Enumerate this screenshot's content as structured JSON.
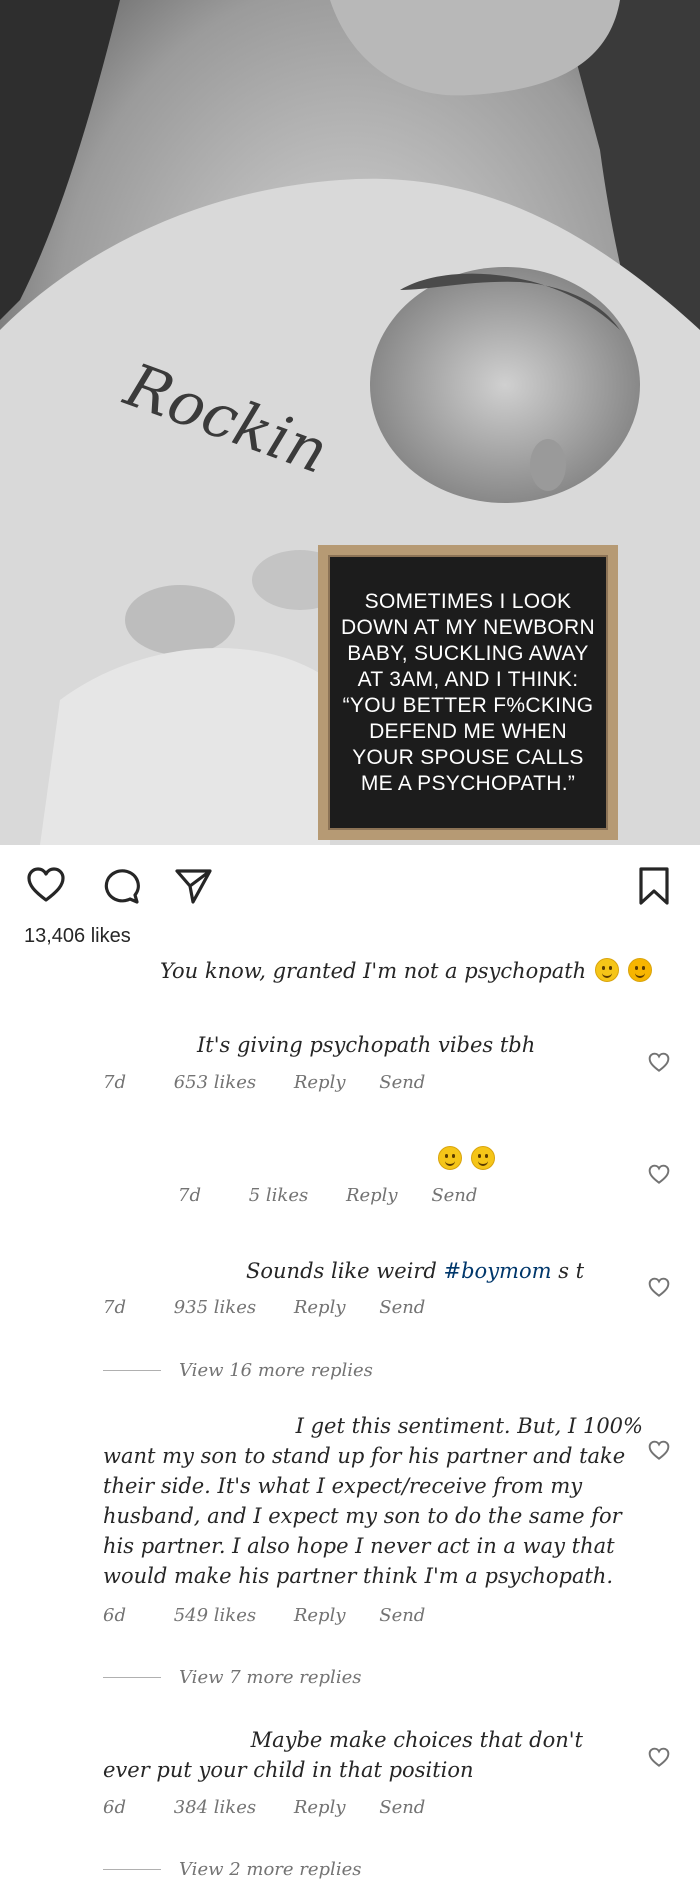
{
  "post": {
    "overlay_text": "SOMETIMES I LOOK DOWN AT MY NEWBORN BABY, SUCKLING AWAY AT 3AM, AND I THINK: “YOU BETTER F%CKING DEFEND ME WHEN YOUR SPOUSE CALLS ME A PSYCHOPATH.”",
    "shirt_text": "Rockin"
  },
  "actions": {
    "icons": [
      "heart-icon",
      "comment-icon",
      "send-icon",
      "bookmark-icon"
    ]
  },
  "likes_count": "13,406 likes",
  "caption": "You know, granted I'm not a psychopath",
  "comments": [
    {
      "text": "It's giving psychopath vibes tbh",
      "age": "7d",
      "likes": "653 likes",
      "reply": "Reply",
      "send": "Send"
    },
    {
      "text": "",
      "age": "7d",
      "likes": "5 likes",
      "reply": "Reply",
      "send": "Send"
    },
    {
      "text_before": "Sounds like weird ",
      "hashtag": "#boymom",
      "text_after": " s  t",
      "age": "7d",
      "likes": "935 likes",
      "reply": "Reply",
      "send": "Send",
      "view_replies": "View 16 more replies"
    },
    {
      "lines": [
        "I get this sentiment. But, I 100%",
        "want my son to stand up for his partner and take",
        "their side. It's what I expect/receive from my",
        "husband, and I expect my son to do the same for",
        "his partner. I also hope I never act in a way that",
        "would make his partner think I'm a psychopath."
      ],
      "age": "6d",
      "likes": "549 likes",
      "reply": "Reply",
      "send": "Send",
      "view_replies": "View 7 more replies"
    },
    {
      "lines": [
        "Maybe make choices that don't",
        "ever put your child in that position"
      ],
      "age": "6d",
      "likes": "384 likes",
      "reply": "Reply",
      "send": "Send",
      "view_replies": "View 2 more replies"
    }
  ]
}
